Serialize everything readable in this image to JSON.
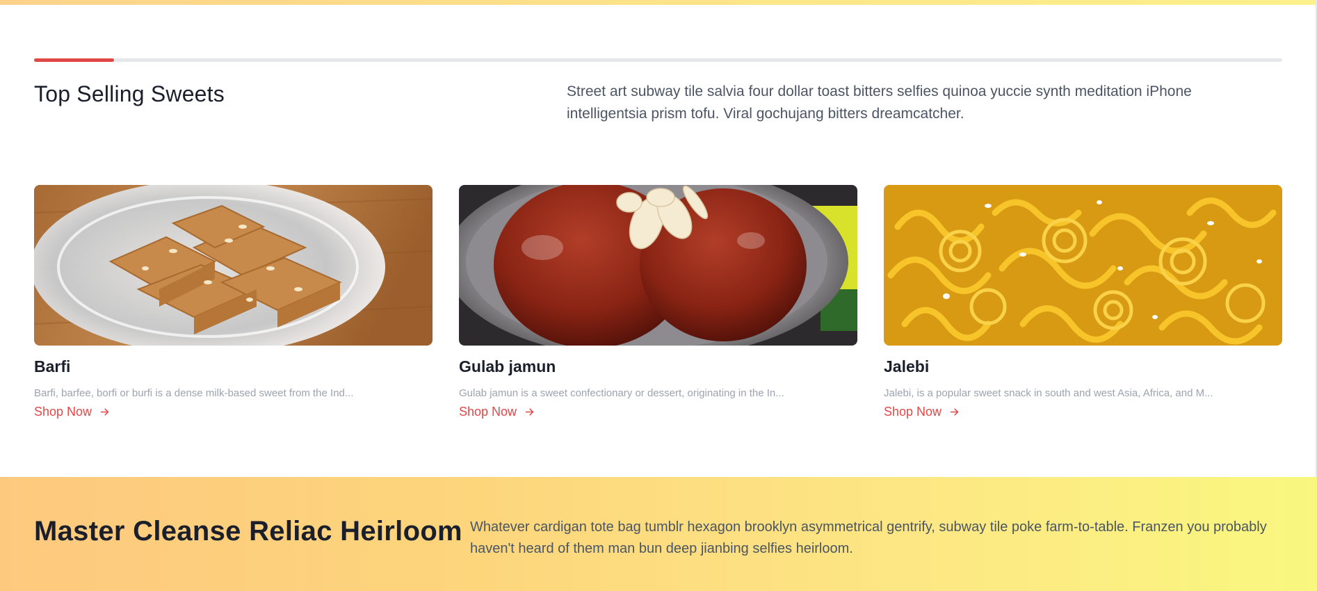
{
  "colors": {
    "accent": "#e04848",
    "banner_start": "#fdc97e",
    "banner_end": "#f9f77f"
  },
  "progress": {
    "fraction": 0.064
  },
  "section": {
    "title": "Top Selling Sweets",
    "description": "Street art subway tile salvia four dollar toast bitters selfies quinoa yuccie synth meditation iPhone intelligentsia prism tofu. Viral gochujang bitters dreamcatcher."
  },
  "products": [
    {
      "name": "Barfi",
      "description": "Barfi, barfee, borfi or burfi is a dense milk-based sweet from the Ind...",
      "link": "Shop Now",
      "icon": "arrow-right-icon"
    },
    {
      "name": "Gulab jamun",
      "description": "Gulab jamun is a sweet confectionary or dessert, originating in the In...",
      "link": "Shop Now",
      "icon": "arrow-right-icon"
    },
    {
      "name": "Jalebi",
      "description": "Jalebi, is a popular sweet snack in south and west Asia, Africa, and M...",
      "link": "Shop Now",
      "icon": "arrow-right-icon"
    }
  ],
  "banner": {
    "title": "Master Cleanse Reliac Heirloom",
    "description": "Whatever cardigan tote bag tumblr hexagon brooklyn asymmetrical gentrify, subway tile poke farm-to-table. Franzen you probably haven't heard of them man bun deep jianbing selfies heirloom."
  }
}
